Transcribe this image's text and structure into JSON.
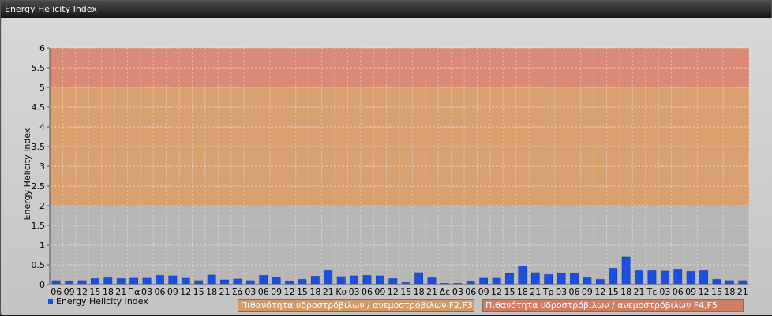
{
  "window": {
    "title": "Energy Helicity Index"
  },
  "legend": {
    "series_label": "Energy Helicity Index"
  },
  "risk_zones": {
    "f23_label": "Πιθανότητα υδροστρόβιλων / ανεμοστρόβιλων F2,F3",
    "f45_label": "Πιθανότητα υδροστρόβιλων / ανεμοστρόβιλων F4,F5",
    "band_low": {
      "from": 0,
      "to": 2,
      "color": "#b6b6b6"
    },
    "band_f23": {
      "from": 2,
      "to": 5,
      "color": "#d9a070"
    },
    "band_f45": {
      "from": 5,
      "to": 6,
      "color": "#d98a74"
    }
  },
  "chart_data": {
    "type": "bar",
    "title": "",
    "xlabel": "",
    "ylabel": "Energy Helicity Index",
    "ylim": [
      0,
      6
    ],
    "yticks": [
      "0",
      "0.5",
      "1",
      "1.5",
      "2",
      "2.5",
      "3",
      "3.5",
      "4",
      "4.5",
      "5",
      "5.5",
      "6"
    ],
    "grid": true,
    "bar_color": "#1a4fe0",
    "categories": [
      "06",
      "09",
      "12",
      "15",
      "18",
      "21",
      "Πα",
      "03",
      "06",
      "09",
      "12",
      "15",
      "18",
      "21",
      "Σά",
      "03",
      "06",
      "09",
      "12",
      "15",
      "18",
      "21",
      "Κυ",
      "03",
      "06",
      "09",
      "12",
      "15",
      "18",
      "21",
      "Δε",
      "03",
      "06",
      "09",
      "12",
      "15",
      "18",
      "21",
      "Τρ",
      "03",
      "06",
      "09",
      "12",
      "15",
      "18",
      "21",
      "Τε",
      "03",
      "06",
      "09",
      "12",
      "15",
      "18",
      "21"
    ],
    "series": [
      {
        "values": [
          0.1,
          0.08,
          0.1,
          0.15,
          0.17,
          0.15,
          0.16,
          0.16,
          0.23,
          0.22,
          0.16,
          0.1,
          0.24,
          0.12,
          0.14,
          0.1,
          0.23,
          0.19,
          0.08,
          0.13,
          0.21,
          0.35,
          0.2,
          0.22,
          0.23,
          0.22,
          0.15,
          0.05,
          0.3,
          0.17,
          0.03,
          0.03,
          0.07,
          0.16,
          0.16,
          0.28,
          0.47,
          0.3,
          0.25,
          0.28,
          0.28,
          0.17,
          0.13,
          0.41,
          0.7,
          0.35,
          0.35,
          0.34,
          0.39,
          0.33,
          0.35,
          0.13,
          0.1,
          0.1
        ]
      }
    ]
  }
}
